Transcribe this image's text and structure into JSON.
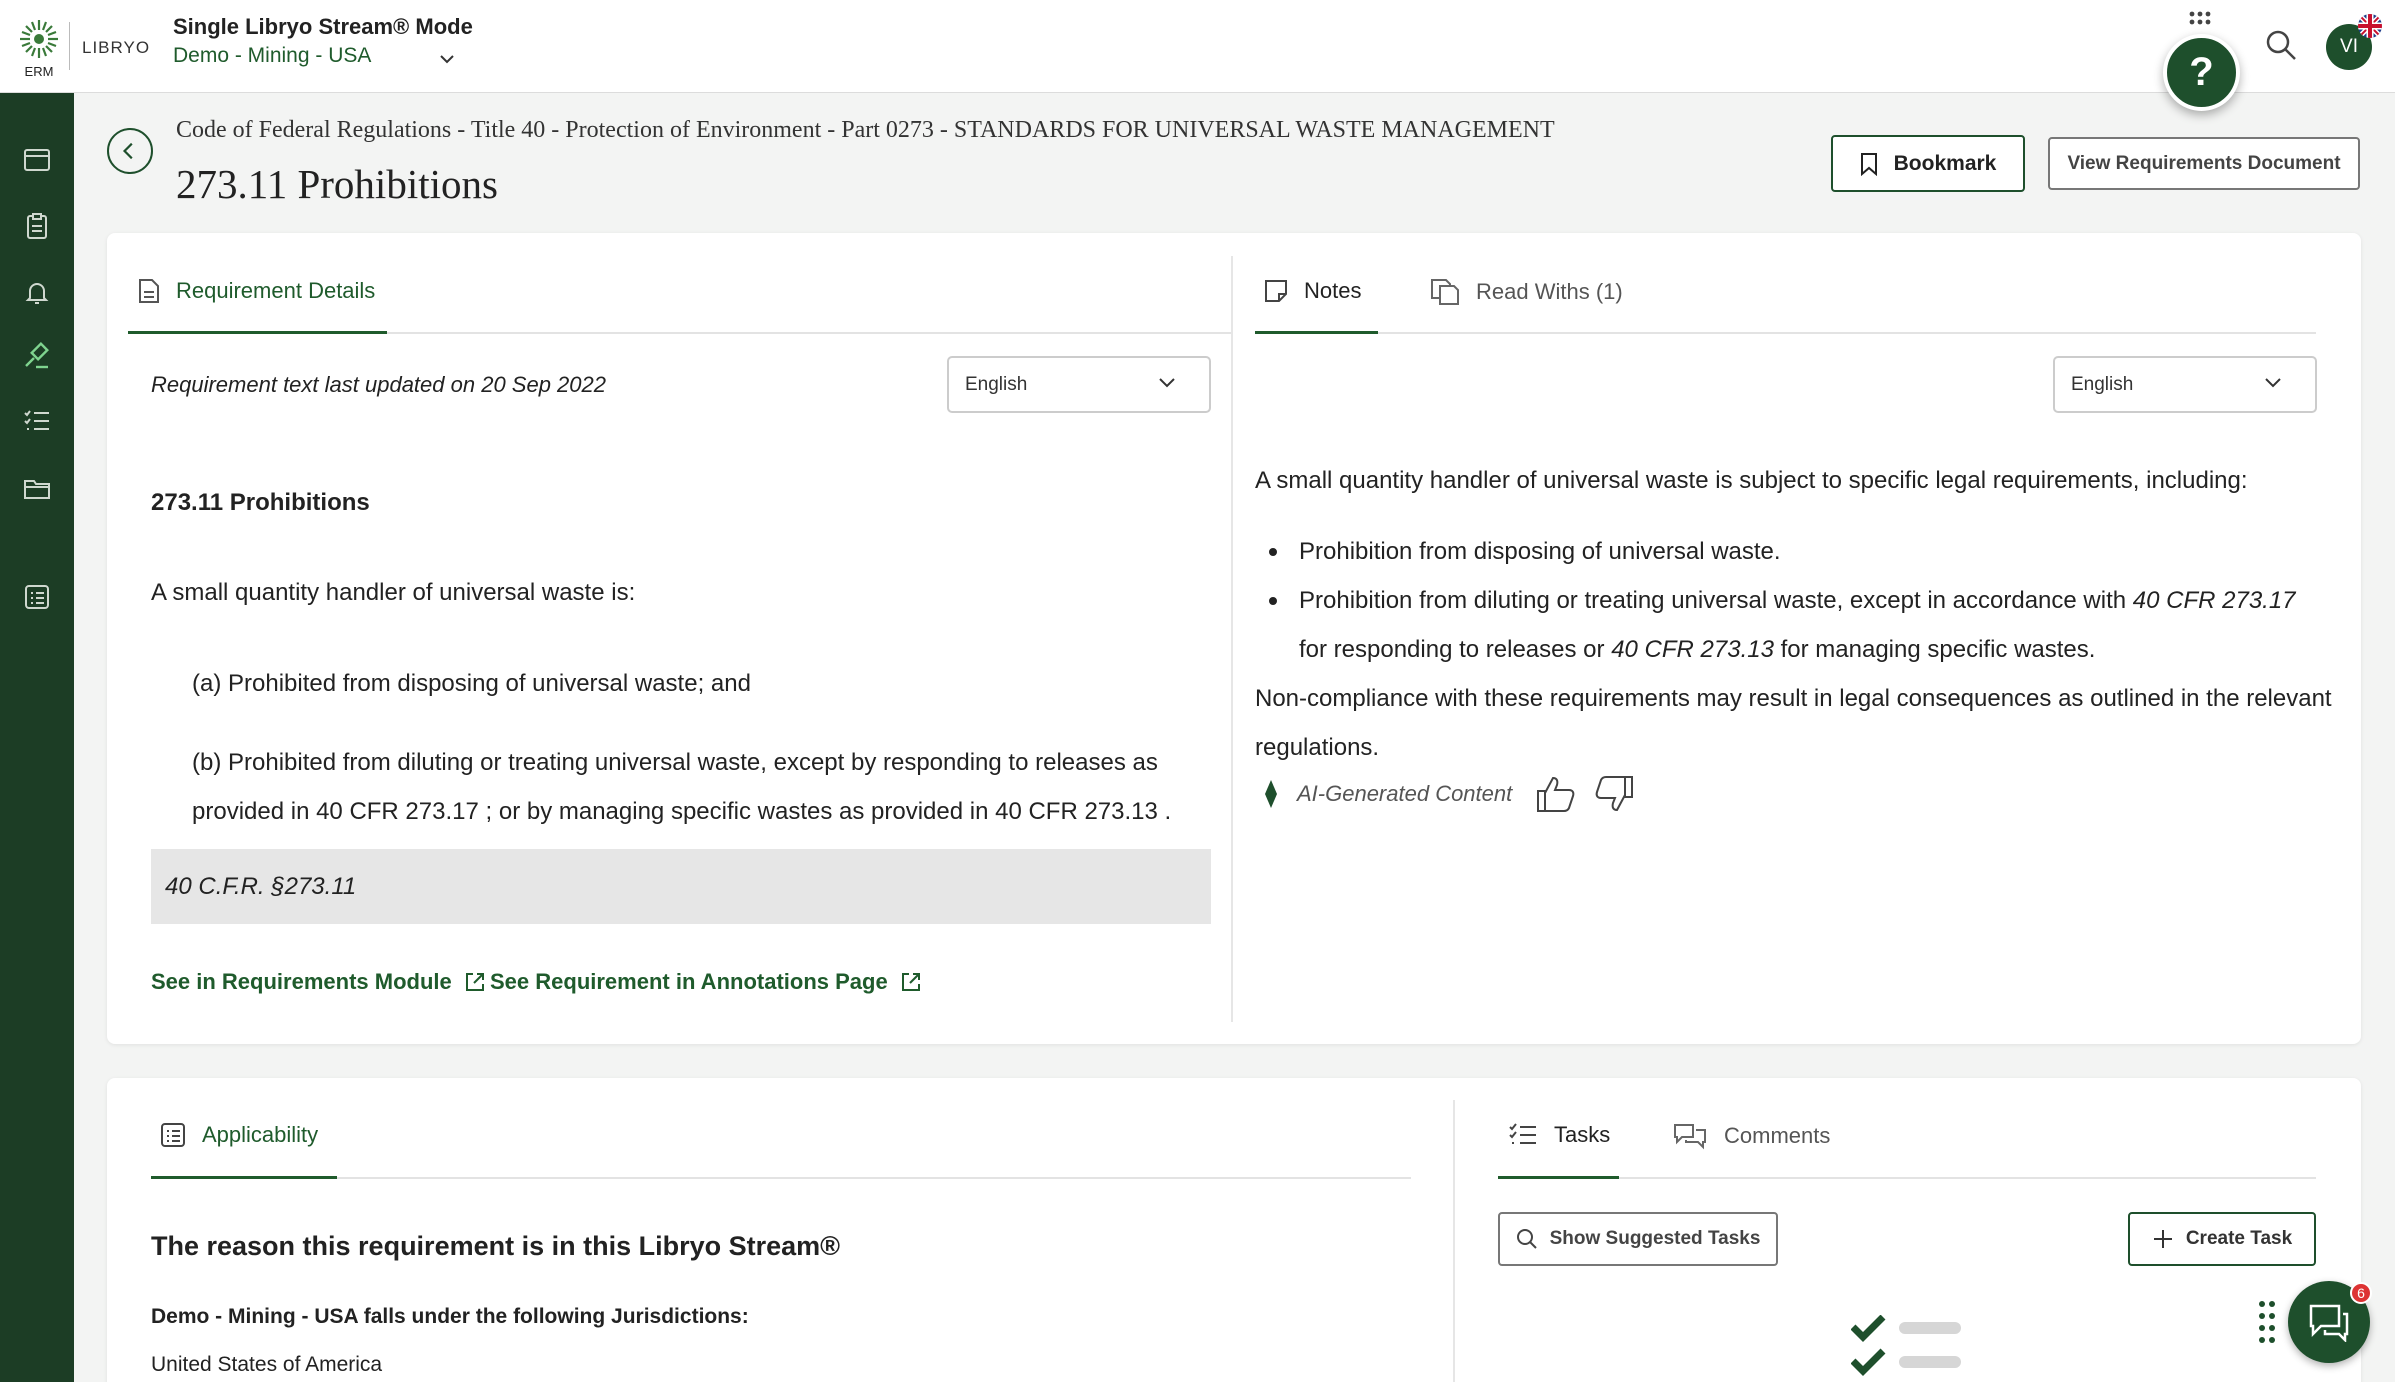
{
  "header": {
    "logo_text": "ERM",
    "brand": "LIBRYO",
    "mode_title": "Single Libryo Stream® Mode",
    "stream_name": "Demo - Mining - USA",
    "help_label": "?",
    "avatar_initials": "VI"
  },
  "page": {
    "breadcrumb": "Code of Federal Regulations - Title 40 - Protection of Environment - Part 0273 - STANDARDS FOR UNIVERSAL WASTE MANAGEMENT",
    "title": "273.11 Prohibitions",
    "bookmark_label": "Bookmark",
    "view_doc_label": "View Requirements Document"
  },
  "requirement": {
    "tab_label": "Requirement Details",
    "last_updated": "Requirement text last updated on 20 Sep 2022",
    "language": "English",
    "heading": "273.11  Prohibitions",
    "intro": "A small quantity handler of universal waste is:",
    "item_a": "(a) Prohibited from disposing of universal waste; and",
    "item_b_line1": "(b) Prohibited from diluting or treating universal waste, except by responding to releases as",
    "item_b_line2": "provided in 40 CFR 273.17 ; or by managing specific wastes as provided in 40 CFR 273.13 .",
    "citation": "40 C.F.R. §273.11",
    "link_module": "See in Requirements Module",
    "link_annotations": "See Requirement in Annotations Page"
  },
  "notes": {
    "tab_notes": "Notes",
    "tab_readwiths": "Read Withs (1)",
    "language": "English",
    "intro": "A small quantity handler of universal waste is subject to specific legal requirements, including:",
    "bullet1": "Prohibition from disposing of universal waste.",
    "bullet2_a": "Prohibition from diluting or treating universal waste, except in accordance with ",
    "bullet2_cfr1": "40 CFR 273.17",
    "bullet2_b": " for responding to releases or ",
    "bullet2_cfr2": "40 CFR 273.13",
    "bullet2_c": " for managing specific wastes.",
    "consequence": "Non-compliance with these requirements may result in legal consequences as outlined in the relevant regulations.",
    "ai_label": "AI-Generated Content"
  },
  "applicability": {
    "tab_label": "Applicability",
    "heading": "The reason this requirement is in this Libryo Stream®",
    "jurisdictions_intro": "Demo - Mining - USA falls under the following Jurisdictions:",
    "jurisdiction": "United States of America"
  },
  "tasks": {
    "tab_tasks": "Tasks",
    "tab_comments": "Comments",
    "suggested_label": "Show Suggested Tasks",
    "create_label": "Create Task"
  },
  "chat": {
    "badge_count": "6"
  },
  "colors": {
    "brand_green": "#1e4f2c",
    "nav_bg": "#1c3d25",
    "accent_text": "#1f5b2c"
  }
}
